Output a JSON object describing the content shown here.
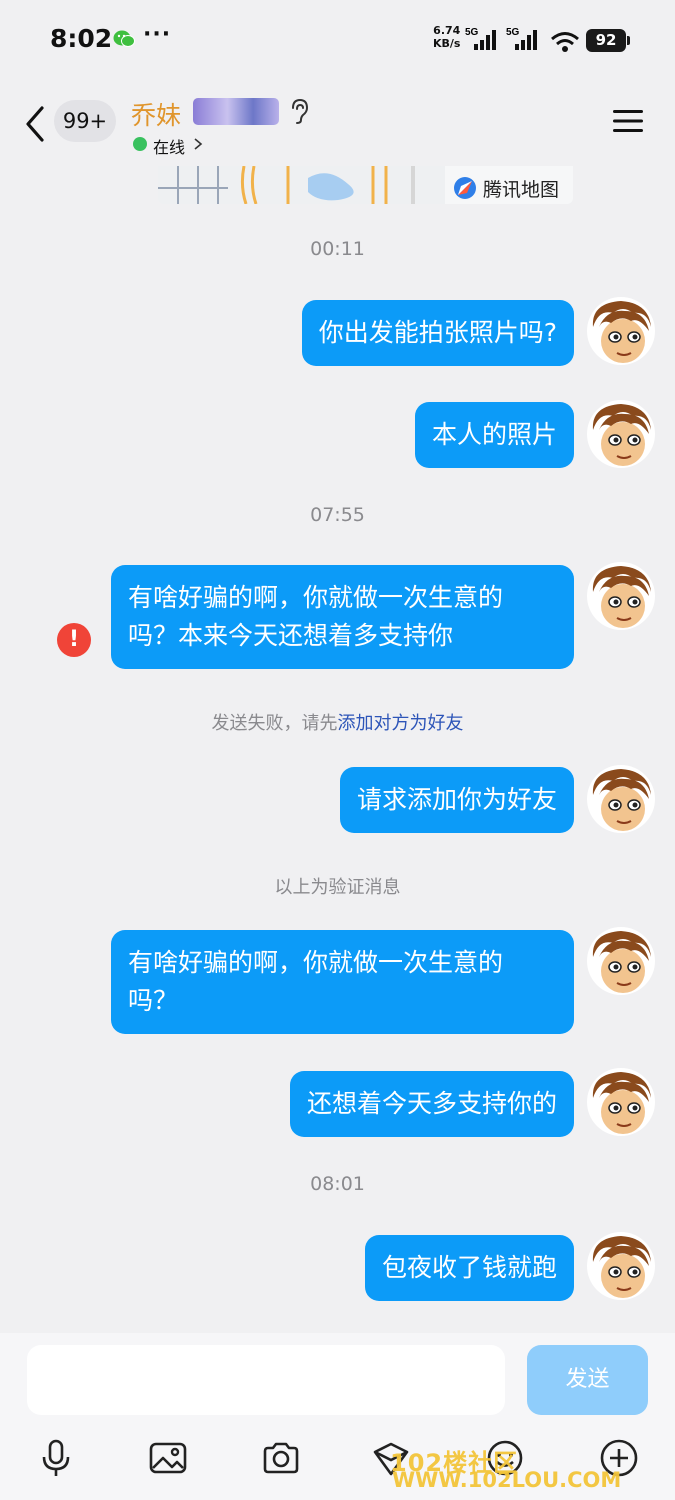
{
  "status_bar": {
    "time": "8:02",
    "dots": "···",
    "net_speed_value": "6.74",
    "net_speed_unit": "KB/s",
    "signal1": "5G",
    "signal2": "5G",
    "battery": "92"
  },
  "header": {
    "unread_count": "99+",
    "contact_name": "乔妹",
    "status": "在线"
  },
  "map": {
    "label": "腾讯地图"
  },
  "messages": [
    {
      "type": "time",
      "text": "00:11"
    },
    {
      "type": "out",
      "text": "你出发能拍张照片吗?"
    },
    {
      "type": "out",
      "text": "本人的照片"
    },
    {
      "type": "time",
      "text": "07:55"
    },
    {
      "type": "out",
      "line1": "有啥好骗的啊，你就做一次生意的",
      "line2": "吗？本来今天还想着多支持你",
      "failed": true
    },
    {
      "type": "system",
      "prefix": "发送失败，请先",
      "link": "添加对方为好友"
    },
    {
      "type": "out",
      "text": "请求添加你为好友"
    },
    {
      "type": "system",
      "text": "以上为验证消息"
    },
    {
      "type": "out",
      "line1": "有啥好骗的啊，你就做一次生意的",
      "line2": "吗？"
    },
    {
      "type": "out",
      "text": "还想着今天多支持你的"
    },
    {
      "type": "time",
      "text": "08:01"
    },
    {
      "type": "out",
      "text": "包夜收了钱就跑"
    }
  ],
  "input": {
    "placeholder": "",
    "send_label": "发送"
  },
  "toolbar": [
    "microphone-icon",
    "image-icon",
    "camera-icon",
    "red-packet-icon",
    "emoji-icon",
    "plus-icon"
  ],
  "watermark": {
    "line1": "102楼社区",
    "line2": "WWW.102LOU.COM"
  },
  "colors": {
    "bubble": "#0c9bf8",
    "send_disabled": "#8fcdfb",
    "name": "#e0952c",
    "online": "#39c15f",
    "error": "#f04438",
    "link": "#2d55b8"
  }
}
